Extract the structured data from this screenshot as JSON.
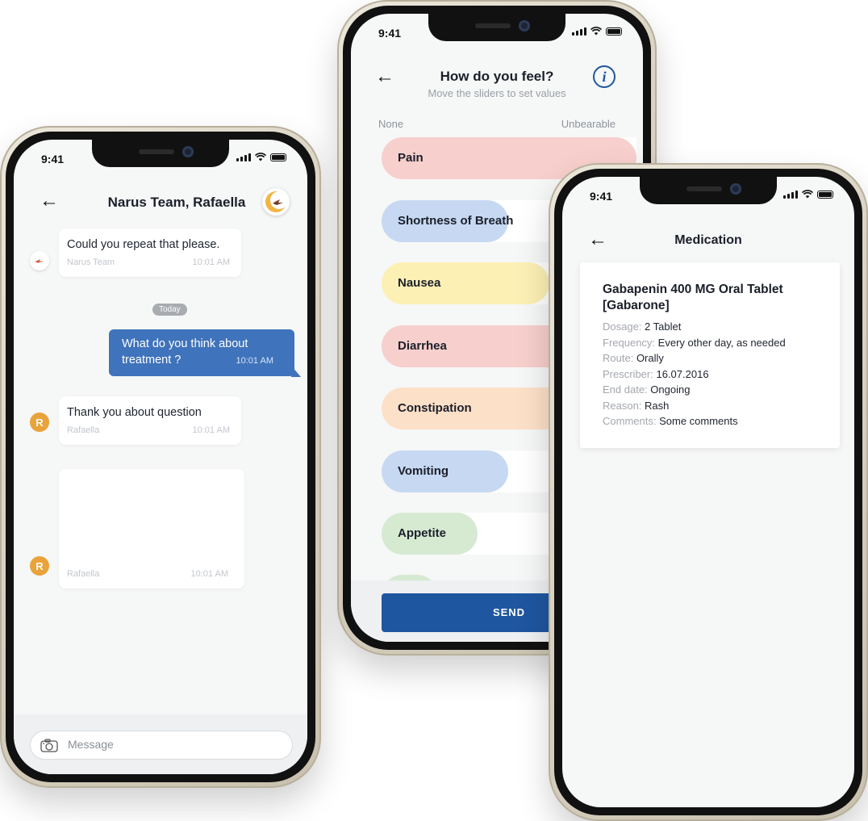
{
  "status": {
    "time": "9:41"
  },
  "chat": {
    "title": "Narus Team, Rafaella",
    "messages": [
      {
        "text": "Could you repeat that please.",
        "sender": "Narus Team",
        "time": "10:01 AM"
      },
      {
        "text": "What do you think about treatment ?",
        "sender": "",
        "time": "10:01 AM"
      },
      {
        "text": "Thank you about question",
        "sender": "Rafaella",
        "time": "10:01 AM"
      },
      {
        "text": "",
        "sender": "Rafaella",
        "time": "10:01 AM"
      }
    ],
    "today_label": "Today",
    "avatar_initial": "R",
    "message_placeholder": "Message"
  },
  "feel": {
    "title": "How do you feel?",
    "subtitle": "Move the sliders to set values",
    "scale_min": "None",
    "scale_max": "Unbearable",
    "sliders": [
      {
        "label": "Pain",
        "value": 1.0,
        "color": "#f7cfcc"
      },
      {
        "label": "Shortness of Breath",
        "value": 0.38,
        "color": "#c7d9f2"
      },
      {
        "label": "Nausea",
        "value": 0.58,
        "color": "#fdf0b5"
      },
      {
        "label": "Diarrhea",
        "value": 0.9,
        "color": "#f7cfcc"
      },
      {
        "label": "Constipation",
        "value": 0.9,
        "color": "#fde0c8"
      },
      {
        "label": "Vomiting",
        "value": 0.38,
        "color": "#c7d9f2"
      },
      {
        "label": "Appetite",
        "value": 0.23,
        "color": "#d6ead2"
      }
    ],
    "send_label": "SEND"
  },
  "medication": {
    "title": "Medication",
    "drug_name": "Gabapenin 400 MG Oral Tablet [Gabarone]",
    "fields": [
      {
        "label": "Dosage:",
        "value": "2 Tablet"
      },
      {
        "label": "Frequency:",
        "value": "Every other day, as needed"
      },
      {
        "label": "Route:",
        "value": "Orally"
      },
      {
        "label": "Prescriber:",
        "value": "16.07.2016"
      },
      {
        "label": "End date:",
        "value": "Ongoing"
      },
      {
        "label": "Reason:",
        "value": "Rash"
      },
      {
        "label": "Comments:",
        "value": "Some comments"
      }
    ]
  }
}
